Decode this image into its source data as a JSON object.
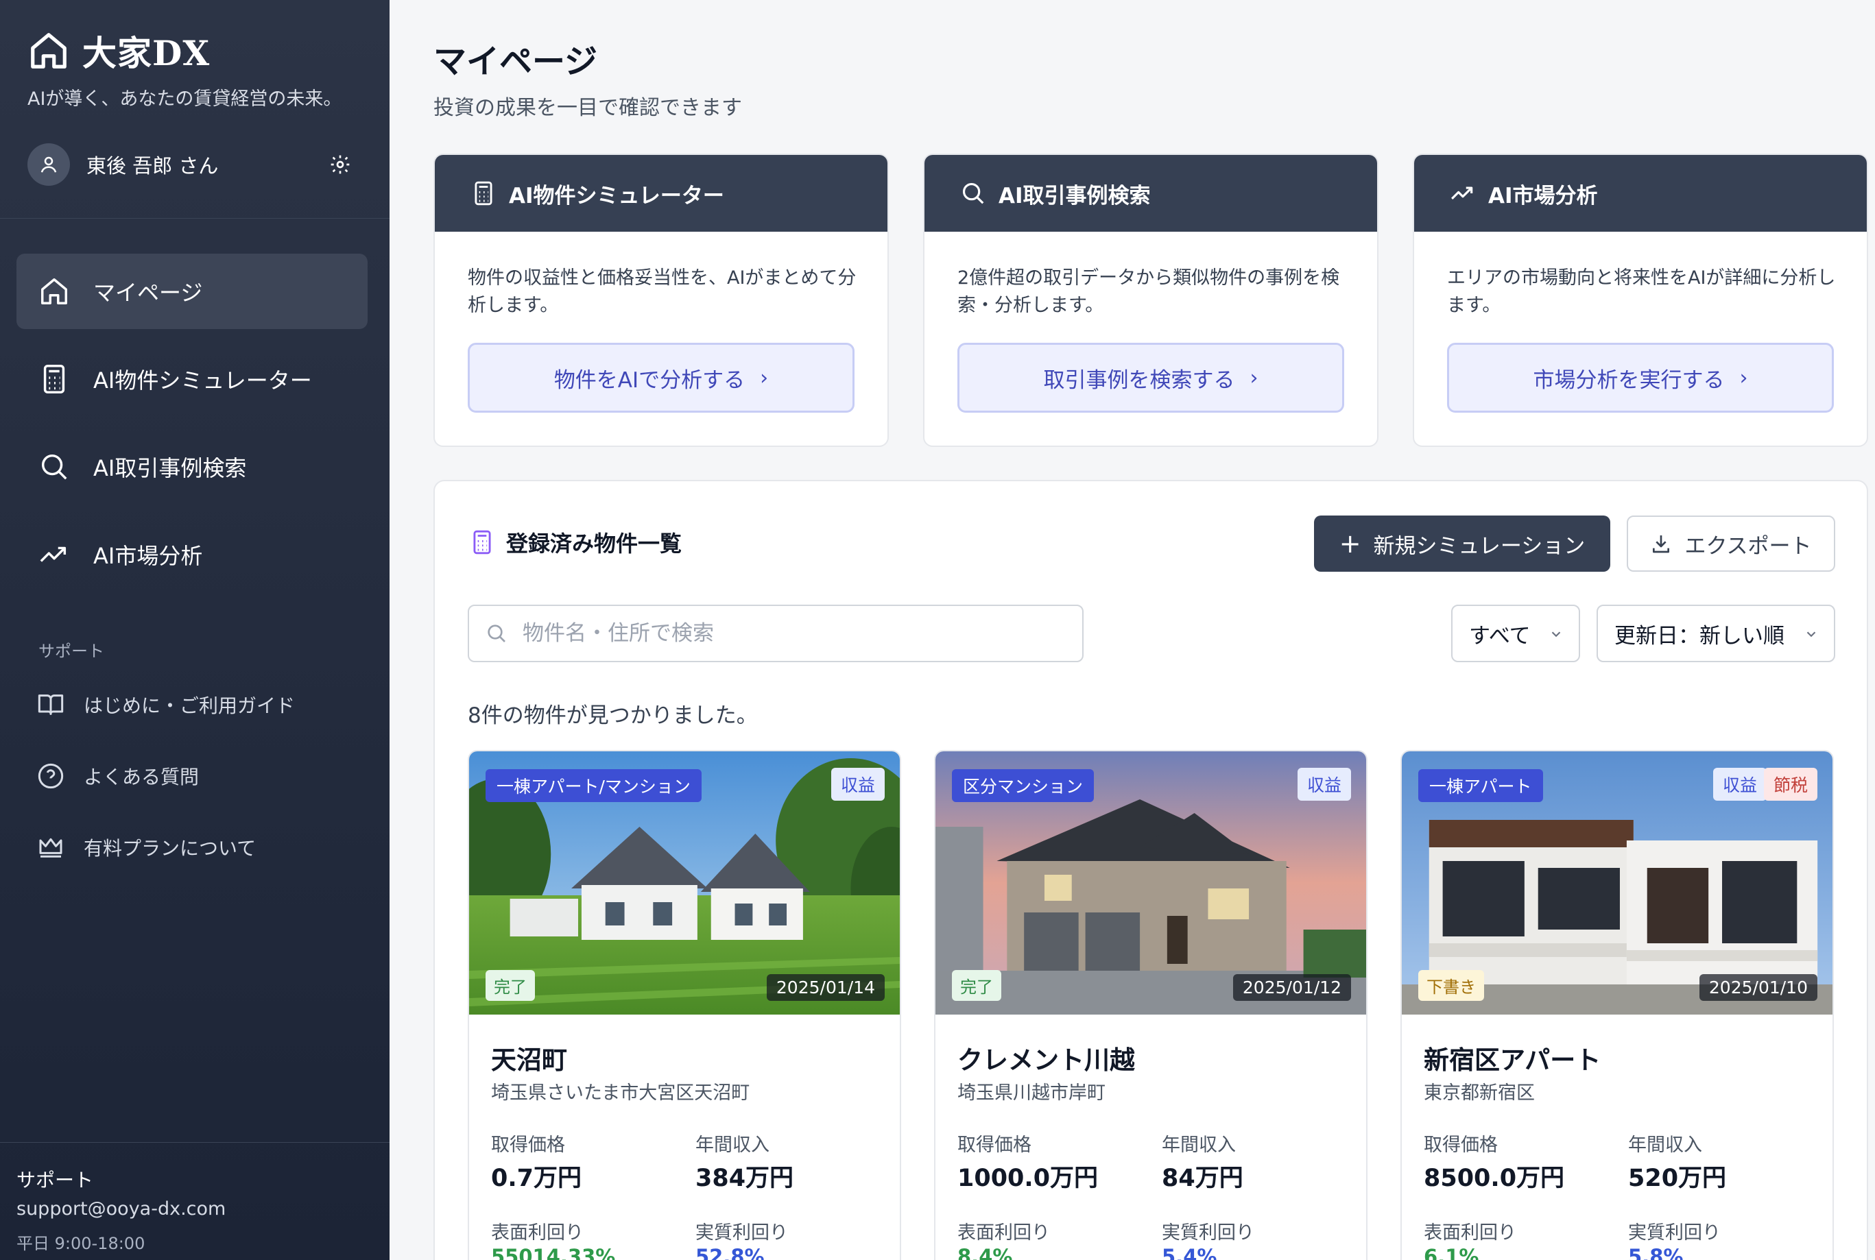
{
  "brand": {
    "name": "大家DX",
    "tagline": "AIが導く、あなたの賃貸経営の未来。"
  },
  "user": {
    "name": "東後 吾郎 さん"
  },
  "nav": [
    {
      "label": "マイページ",
      "icon": "home-icon",
      "active": true
    },
    {
      "label": "AI物件シミュレーター",
      "icon": "calculator-icon"
    },
    {
      "label": "AI取引事例検索",
      "icon": "search-icon"
    },
    {
      "label": "AI市場分析",
      "icon": "trending-up-icon"
    }
  ],
  "support_section": {
    "heading": "サポート",
    "items": [
      {
        "label": "はじめに・ご利用ガイド",
        "icon": "book-icon"
      },
      {
        "label": "よくある質問",
        "icon": "help-circle-icon"
      },
      {
        "label": "有料プランについて",
        "icon": "crown-icon"
      }
    ]
  },
  "footer": {
    "title": "サポート",
    "email": "support@ooya-dx.com",
    "hours": "平日 9:00-18:00"
  },
  "page": {
    "title": "マイページ",
    "subtitle": "投資の成果を一目で確認できます"
  },
  "tools": [
    {
      "title": "AI物件シミュレーター",
      "icon": "calculator-icon",
      "desc": "物件の収益性と価格妥当性を、AIがまとめて分析します。",
      "button": "物件をAIで分析する"
    },
    {
      "title": "AI取引事例検索",
      "icon": "search-icon",
      "desc": "2億件超の取引データから類似物件の事例を検索・分析します。",
      "button": "取引事例を検索する"
    },
    {
      "title": "AI市場分析",
      "icon": "trending-up-icon",
      "desc": "エリアの市場動向と将来性をAIが詳細に分析します。",
      "button": "市場分析を実行する"
    }
  ],
  "list": {
    "title": "登録済み物件一覧",
    "new_button": "新規シミュレーション",
    "export_button": "エクスポート",
    "search_placeholder": "物件名・住所で検索",
    "filter_value": "すべて",
    "sort_value": "更新日：新しい順",
    "count_text": "8件の物件が見つかりました。"
  },
  "labels": {
    "price": "取得価格",
    "income": "年間収入",
    "gross_yield": "表面利回り",
    "net_yield": "実質利回り"
  },
  "properties": [
    {
      "type": "一棟アパート/マンション",
      "tags": [
        "収益"
      ],
      "status": "完了",
      "date": "2025/01/14",
      "name": "天沼町",
      "address": "埼玉県さいたま市大宮区天沼町",
      "price": "0.7万円",
      "income": "384万円",
      "gross_yield": "55014.33%",
      "net_yield": "52.8%"
    },
    {
      "type": "区分マンション",
      "tags": [
        "収益"
      ],
      "status": "完了",
      "date": "2025/01/12",
      "name": "クレメント川越",
      "address": "埼玉県川越市岸町",
      "price": "1000.0万円",
      "income": "84万円",
      "gross_yield": "8.4%",
      "net_yield": "5.4%"
    },
    {
      "type": "一棟アパート",
      "tags": [
        "収益",
        "節税"
      ],
      "status": "下書き",
      "date": "2025/01/10",
      "name": "新宿区アパート",
      "address": "東京都新宿区",
      "price": "8500.0万円",
      "income": "520万円",
      "gross_yield": "6.1%",
      "net_yield": "5.8%"
    }
  ]
}
